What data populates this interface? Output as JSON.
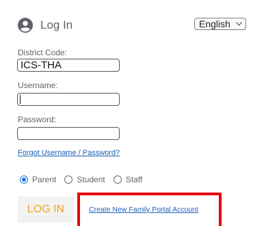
{
  "header": {
    "title": "Log In",
    "user_icon": "account-circle-icon"
  },
  "language": {
    "selected": "English"
  },
  "district_code": {
    "label": "District Code:",
    "value": "ICS-THA"
  },
  "username": {
    "label": "Username:",
    "value": ""
  },
  "password": {
    "label": "Password:",
    "value": ""
  },
  "forgot_link": "Forgot Username / Password?",
  "roles": [
    {
      "label": "Parent",
      "checked": true
    },
    {
      "label": "Student",
      "checked": false
    },
    {
      "label": "Staff",
      "checked": false
    }
  ],
  "login_button": "LOG IN",
  "create_account_link": "Create New Family Portal Account",
  "colors": {
    "accent": "#1a73e8",
    "login_text": "#f1a51f",
    "highlight": "#e5050a",
    "link": "#1a5fb4"
  }
}
